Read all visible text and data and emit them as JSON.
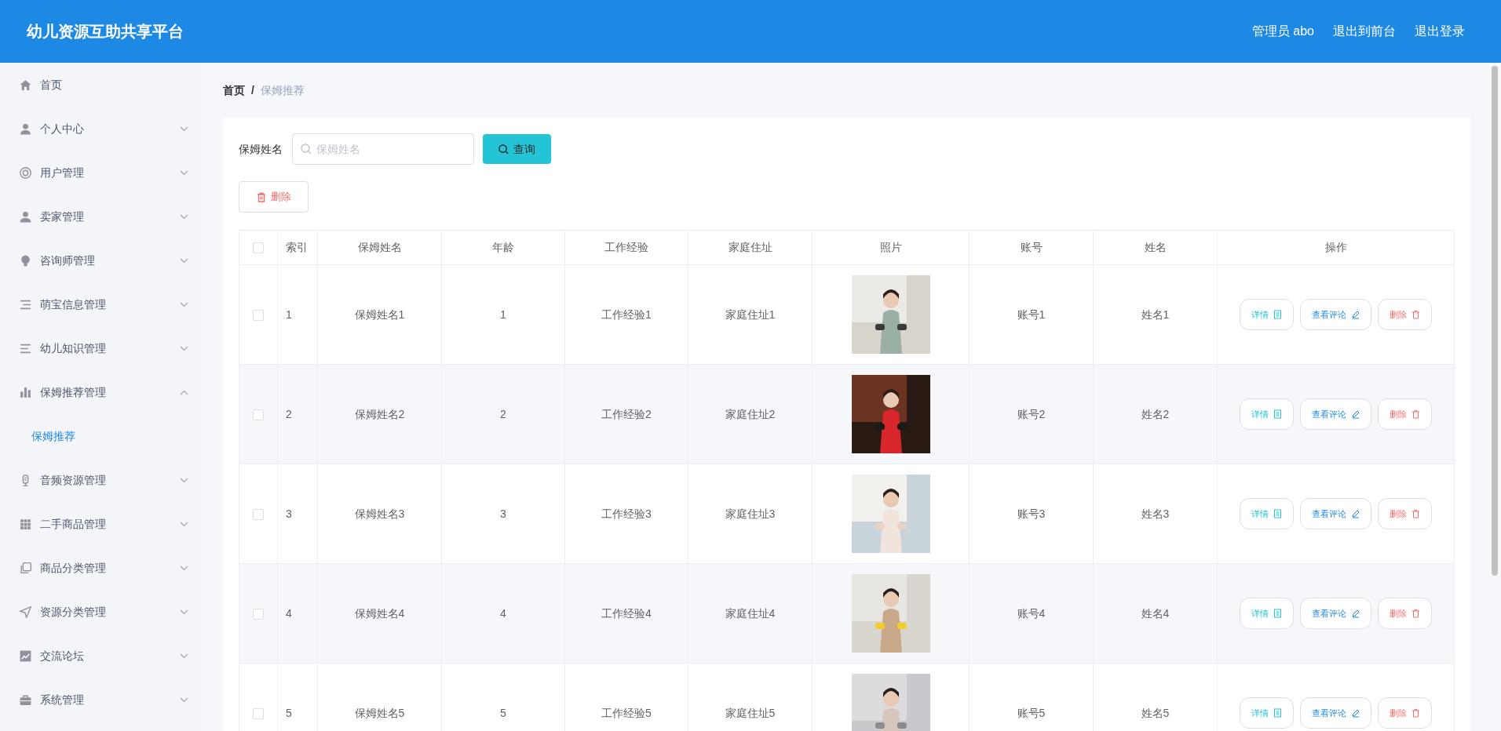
{
  "header": {
    "title": "幼儿资源互助共享平台",
    "user_menu": [
      "管理员 abo",
      "退出到前台",
      "退出登录"
    ]
  },
  "sidebar": {
    "items": [
      {
        "kind": "link",
        "label": "首页",
        "selected": false
      },
      {
        "kind": "submenu",
        "label": "个人中心",
        "expanded": false
      },
      {
        "kind": "submenu",
        "label": "用户管理",
        "expanded": false
      },
      {
        "kind": "submenu",
        "label": "卖家管理",
        "expanded": false
      },
      {
        "kind": "submenu",
        "label": "咨询师管理",
        "expanded": false
      },
      {
        "kind": "submenu",
        "label": "萌宝信息管理",
        "expanded": false
      },
      {
        "kind": "submenu",
        "label": "幼儿知识管理",
        "expanded": false
      },
      {
        "kind": "submenu",
        "label": "保姆推荐管理",
        "expanded": true,
        "children": [
          {
            "label": "保姆推荐",
            "selected": true
          }
        ]
      },
      {
        "kind": "submenu",
        "label": "音频资源管理",
        "expanded": false
      },
      {
        "kind": "submenu",
        "label": "二手商品管理",
        "expanded": false
      },
      {
        "kind": "submenu",
        "label": "商品分类管理",
        "expanded": false
      },
      {
        "kind": "submenu",
        "label": "资源分类管理",
        "expanded": false
      },
      {
        "kind": "submenu",
        "label": "交流论坛",
        "expanded": false
      },
      {
        "kind": "submenu",
        "label": "系统管理",
        "expanded": false
      }
    ]
  },
  "breadcrumb": [
    "首页",
    "/",
    "保姆推荐"
  ],
  "search": {
    "label": "保姆姓名",
    "placeholder": "保姆姓名",
    "button": "查询"
  },
  "toolbar": {
    "delete_button": "删除"
  },
  "table": {
    "columns": [
      "索引",
      "保姆姓名",
      "年龄",
      "工作经验",
      "家庭住址",
      "照片",
      "账号",
      "姓名",
      "操作"
    ],
    "all_checked": false,
    "rows": [
      {
        "checked": false,
        "cells": [
          "1",
          "保姆姓名1",
          "1",
          "工作经验1",
          "家庭住址1"
        ],
        "photo": {
          "kind": "picture"
        },
        "cells_after": [
          "账号1",
          "姓名1"
        ],
        "actions": [
          "详情",
          "查看评论",
          "删除"
        ]
      },
      {
        "checked": false,
        "cells": [
          "2",
          "保姆姓名2",
          "2",
          "工作经验2",
          "家庭住址2"
        ],
        "photo": {
          "kind": "picture"
        },
        "cells_after": [
          "账号2",
          "姓名2"
        ],
        "actions": [
          "详情",
          "查看评论",
          "删除"
        ]
      },
      {
        "checked": false,
        "cells": [
          "3",
          "保姆姓名3",
          "3",
          "工作经验3",
          "家庭住址3"
        ],
        "photo": {
          "kind": "picture"
        },
        "cells_after": [
          "账号3",
          "姓名3"
        ],
        "actions": [
          "详情",
          "查看评论",
          "删除"
        ]
      },
      {
        "checked": false,
        "cells": [
          "4",
          "保姆姓名4",
          "4",
          "工作经验4",
          "家庭住址4"
        ],
        "photo": {
          "kind": "picture"
        },
        "cells_after": [
          "账号4",
          "姓名4"
        ],
        "actions": [
          "详情",
          "查看评论",
          "删除"
        ]
      },
      {
        "checked": false,
        "cells": [
          "5",
          "保姆姓名5",
          "5",
          "工作经验5",
          "家庭住址5"
        ],
        "photo": {
          "kind": "picture"
        },
        "cells_after": [
          "账号5",
          "姓名5"
        ],
        "actions": [
          "详情",
          "查看评论",
          "删除"
        ]
      }
    ]
  }
}
